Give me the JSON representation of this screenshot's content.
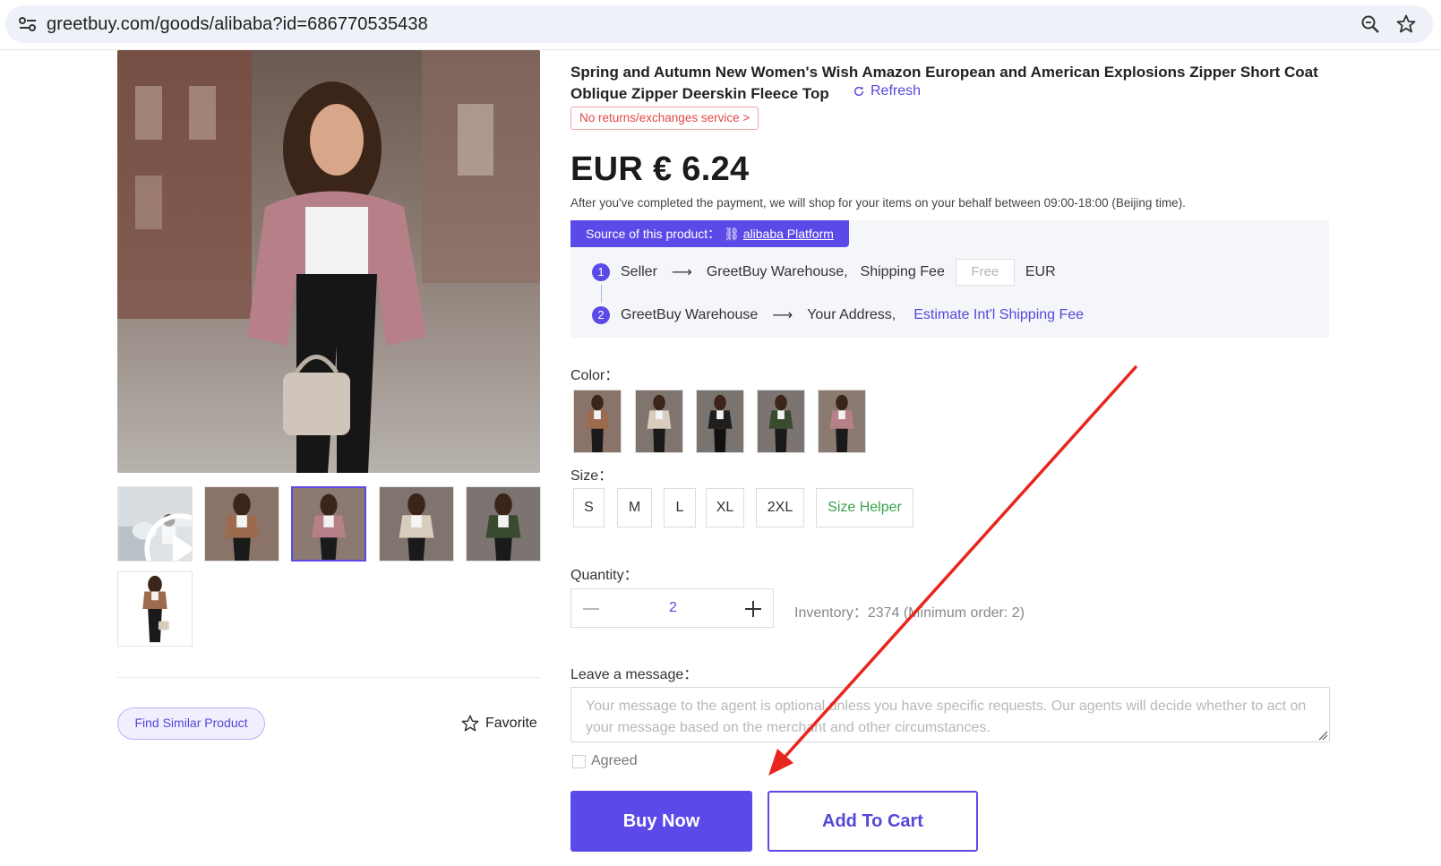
{
  "browser": {
    "url": "greetbuy.com/goods/alibaba?id=686770535438",
    "icons": [
      "site-settings-icon",
      "zoom-icon",
      "bookmark-star-icon"
    ]
  },
  "gallery": {
    "thumbnails": [
      {
        "name": "video-thumbnail",
        "has_play": true
      },
      {
        "name": "brown-jacket"
      },
      {
        "name": "pink-jacket",
        "active": true
      },
      {
        "name": "beige-jacket"
      },
      {
        "name": "green-jacket"
      },
      {
        "name": "brown-jacket-full"
      }
    ],
    "find_similar_label": "Find Similar Product",
    "favorite_label": "Favorite"
  },
  "product": {
    "title": "Spring and Autumn New Women's Wish Amazon European and American Explosions Zipper Short Coat Oblique Zipper Deerskin Fleece Top",
    "refresh_label": "Refresh",
    "no_returns_label": "No returns/exchanges service >",
    "price": "EUR € 6.24",
    "purchase_note": "After you've completed the payment, we will shop for your items on your behalf between 09:00-18:00 (Beijing time)."
  },
  "source": {
    "prefix": "Source of this product：",
    "platform_link": "alibaba Platform",
    "step1": {
      "num": "1",
      "from": "Seller",
      "to": "GreetBuy Warehouse,",
      "fee_label": "Shipping Fee",
      "fee_value": "Free",
      "currency": "EUR"
    },
    "step2": {
      "num": "2",
      "from": "GreetBuy Warehouse",
      "to": "Your Address,",
      "estimate_link": "Estimate Int'l Shipping Fee"
    }
  },
  "options": {
    "color_label": "Color：",
    "colors": [
      "brown",
      "beige",
      "black",
      "green",
      "pink"
    ],
    "size_label": "Size：",
    "sizes": [
      "S",
      "M",
      "L",
      "XL",
      "2XL"
    ],
    "size_helper": "Size Helper"
  },
  "quantity": {
    "label": "Quantity：",
    "value": "2",
    "inventory": "Inventory：2374 (Minimum order: 2)"
  },
  "message": {
    "label": "Leave a message：",
    "placeholder": "Your message to the agent is optional unless you have specific requests. Our agents will decide whether to act on your message based on the merchant and other circumstances."
  },
  "agreement": {
    "label": "Agreed"
  },
  "actions": {
    "buy_now": "Buy Now",
    "add_to_cart": "Add To Cart"
  },
  "colors": {
    "accent": "#5b4ae8",
    "danger": "#e24848",
    "success": "#3aa24b",
    "annotation_arrow": "#e8261d"
  }
}
